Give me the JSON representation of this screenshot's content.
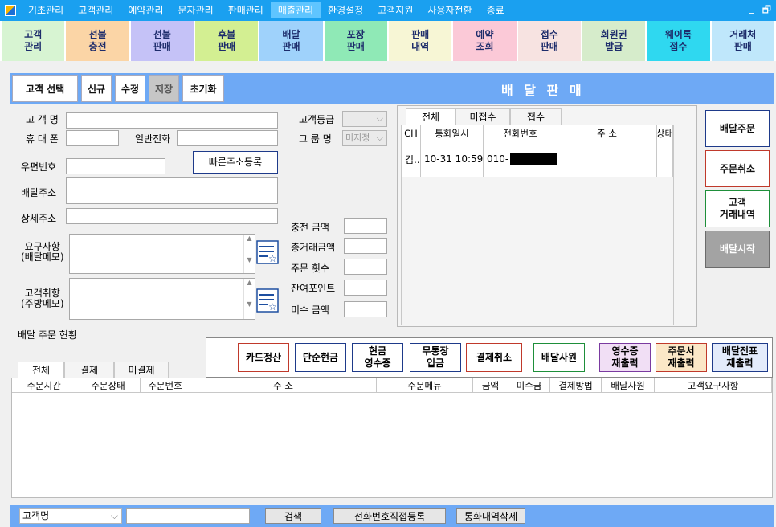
{
  "menu": {
    "items": [
      "기초관리",
      "고객관리",
      "예약관리",
      "문자관리",
      "판매관리",
      "매출관리",
      "환경설정",
      "고객지원",
      "사용자전환",
      "종료"
    ],
    "active_index": 5,
    "win_min": "_",
    "win_max": "🗗"
  },
  "tiles": [
    {
      "label": "고객\n관리",
      "color": "#d7f4d2"
    },
    {
      "label": "선불\n충전",
      "color": "#fbd5a6"
    },
    {
      "label": "선불\n판매",
      "color": "#c5c2f7"
    },
    {
      "label": "후불\n판매",
      "color": "#d3ef92"
    },
    {
      "label": "배달\n판매",
      "color": "#9fd2fb"
    },
    {
      "label": "포장\n판매",
      "color": "#8fe9b6"
    },
    {
      "label": "판매\n내역",
      "color": "#f7f6d5"
    },
    {
      "label": "예약\n조회",
      "color": "#fbc9d7"
    },
    {
      "label": "접수\n판매",
      "color": "#f7e3e1"
    },
    {
      "label": "회원권\n발급",
      "color": "#d6eccb"
    },
    {
      "label": "웨이톡\n접수",
      "color": "#2fd8f0"
    },
    {
      "label": "거래처\n판매",
      "color": "#bfe7fb"
    }
  ],
  "header": {
    "title": "배 달 판 매",
    "buttons": [
      "고객 선택",
      "신규",
      "수정",
      "저장",
      "초기화"
    ]
  },
  "customer": {
    "name_label": "고 객 명",
    "mobile_label": "휴 대 폰",
    "phone_label": "일반전화",
    "zip_label": "우편번호",
    "quick_addr_button": "빠른주소등록",
    "addr_label": "배달주소",
    "addr_detail_label": "상세주소",
    "request_label": "요구사항\n(배달메모)",
    "pref_label": "고객취향\n(주방메모)",
    "grade_label": "고객등급",
    "group_label": "그 룹 명",
    "group_value": "미지정",
    "charge_label": "충전  금액",
    "total_label": "총거래금액",
    "order_count_label": "주문  횟수",
    "points_label": "잔여포인트",
    "unpaid_label": "미수  금액"
  },
  "calls": {
    "tabs": [
      "전체",
      "미접수",
      "접수"
    ],
    "columns": [
      "CH",
      "통화일시",
      "전화번호",
      "주    소",
      "상태"
    ],
    "rows": [
      {
        "ch": "김...",
        "datetime": "10-31 10:59",
        "phone": "010-",
        "address": "",
        "status": ""
      }
    ]
  },
  "side_buttons": [
    {
      "label": "배달주문",
      "border": "#1e3a8a",
      "bg": "#ffffff",
      "color": "#111111"
    },
    {
      "label": "주문취소",
      "border": "#c0392b",
      "bg": "#ffffff",
      "color": "#111111"
    },
    {
      "label": "고객\n거래내역",
      "border": "#1e8f3a",
      "bg": "#ffffff",
      "color": "#111111"
    },
    {
      "label": "배달시작",
      "border": "#6b6b6b",
      "bg": "#a3a3a3",
      "color": "#ffffff"
    }
  ],
  "orders": {
    "section_title": "배달 주문 현황",
    "tabs": [
      "전체",
      "결제",
      "미결제"
    ],
    "action_buttons": [
      {
        "label": "카드정산",
        "border": "#c0392b"
      },
      {
        "label": "단순현금",
        "border": "#1e3a8a"
      },
      {
        "label": "현금\n영수증",
        "border": "#1e3a8a"
      },
      {
        "label": "무통장\n입금",
        "border": "#1e3a8a"
      },
      {
        "label": "결제취소",
        "border": "#c0392b"
      },
      {
        "label": "배달사원",
        "border": "#1e8f3a"
      },
      {
        "label": "영수증\n재출력",
        "border": "#7a3aa0",
        "bg": "#f1dff5"
      },
      {
        "label": "주문서\n재출력",
        "border": "#c0392b",
        "bg": "#fbe7c7"
      },
      {
        "label": "배달전표\n재출력",
        "border": "#1e3a8a",
        "bg": "#e3ebfb"
      }
    ],
    "columns": [
      "주문시간",
      "주문상태",
      "주문번호",
      "주    소",
      "주문메뉴",
      "금액",
      "미수금",
      "결제방법",
      "배달사원",
      "고객요구사항"
    ]
  },
  "search": {
    "combo_value": "고객명",
    "search_button": "검색",
    "direct_register_button": "전화번호직접등록",
    "delete_history_button": "통화내역삭제"
  }
}
